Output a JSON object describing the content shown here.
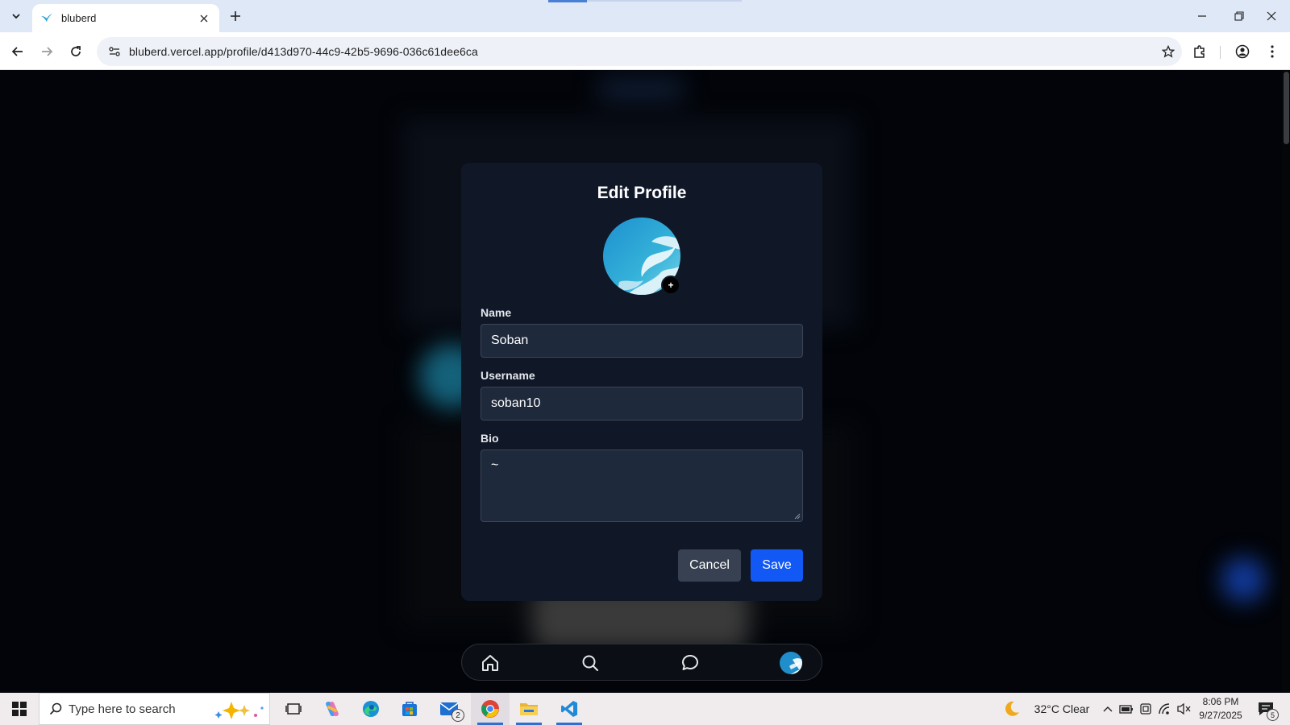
{
  "browser": {
    "tab_title": "bluberd",
    "url": "bluberd.vercel.app/profile/d413d970-44c9-42b5-9696-036c61dee6ca"
  },
  "modal": {
    "title": "Edit Profile",
    "add_photo_label": "+",
    "fields": {
      "name_label": "Name",
      "name_value": "Soban",
      "username_label": "Username",
      "username_value": "soban10",
      "bio_label": "Bio",
      "bio_value": "~"
    },
    "cancel_label": "Cancel",
    "save_label": "Save",
    "colors": {
      "background": "#101828",
      "input": "#1e293b",
      "save": "#1158f5",
      "cancel": "#374151"
    }
  },
  "bottom_nav": {
    "items": [
      "home-icon",
      "search-icon",
      "chat-icon",
      "profile-avatar"
    ]
  },
  "taskbar": {
    "search_placeholder": "Type here to search",
    "mail_badge": "2",
    "weather": "32°C  Clear",
    "time": "8:06 PM",
    "date": "9/27/2025",
    "notification_count": "5"
  }
}
